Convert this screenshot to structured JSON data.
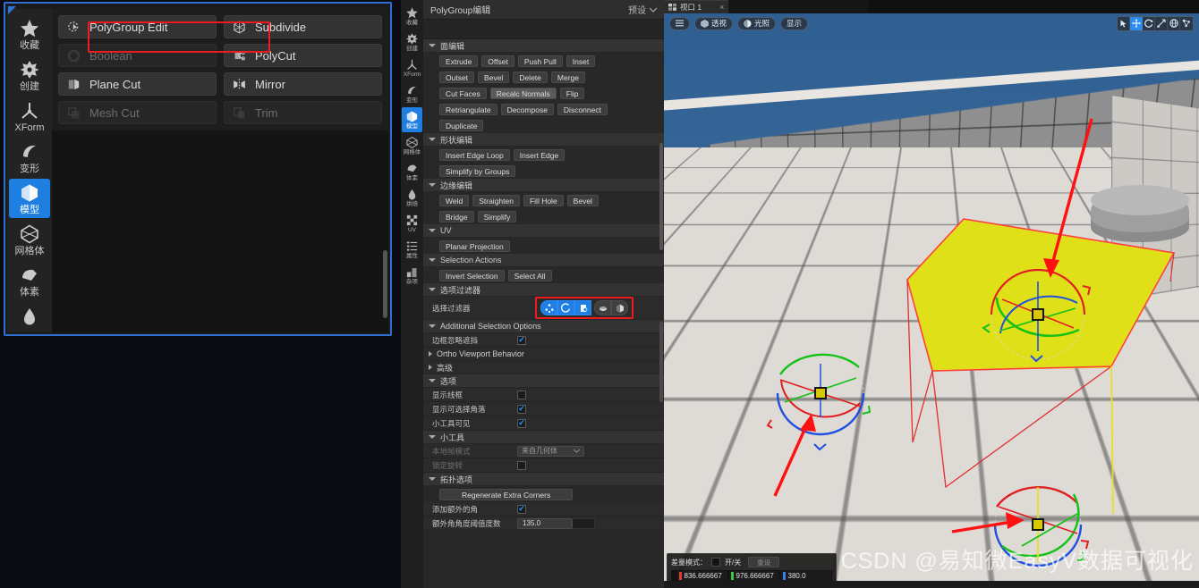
{
  "left_palette": {
    "rail_items": [
      {
        "label": "收藏",
        "icon": "star-icon",
        "active": false
      },
      {
        "label": "创建",
        "icon": "create-shape-icon",
        "active": false
      },
      {
        "label": "XForm",
        "icon": "xform-axis-icon",
        "active": false
      },
      {
        "label": "变形",
        "icon": "deform-icon",
        "active": false
      },
      {
        "label": "模型",
        "icon": "model-cube-icon",
        "active": true
      },
      {
        "label": "网格体",
        "icon": "mesh-polyhedron-icon",
        "active": false
      },
      {
        "label": "体素",
        "icon": "voxel-icon",
        "active": false
      },
      {
        "label": "",
        "icon": "bake-drop-icon",
        "active": false
      }
    ],
    "tools": [
      {
        "label": "PolyGroup Edit",
        "icon": "polygroup-edit-icon",
        "enabled": true,
        "highlighted": true
      },
      {
        "label": "Subdivide",
        "icon": "subdivide-icon",
        "enabled": true,
        "highlighted": false
      },
      {
        "label": "Boolean",
        "icon": "boolean-icon",
        "enabled": false,
        "highlighted": false
      },
      {
        "label": "PolyCut",
        "icon": "polycut-icon",
        "enabled": true,
        "highlighted": false
      },
      {
        "label": "Plane Cut",
        "icon": "plane-cut-icon",
        "enabled": true,
        "highlighted": false
      },
      {
        "label": "Mirror",
        "icon": "mirror-icon",
        "enabled": true,
        "highlighted": false
      },
      {
        "label": "Mesh Cut",
        "icon": "mesh-cut-icon",
        "enabled": false,
        "highlighted": false
      },
      {
        "label": "Trim",
        "icon": "trim-icon",
        "enabled": false,
        "highlighted": false
      }
    ],
    "highlight_color": "#ee1c1c",
    "border_color": "#2e6fd0"
  },
  "mid_panel": {
    "rail_items": [
      {
        "label": "收藏",
        "icon": "star-icon",
        "active": false
      },
      {
        "label": "创建",
        "icon": "create-shape-icon",
        "active": false
      },
      {
        "label": "XForm",
        "icon": "xform-axis-icon",
        "active": false
      },
      {
        "label": "变形",
        "icon": "deform-icon",
        "active": false
      },
      {
        "label": "模型",
        "icon": "model-cube-icon",
        "active": true
      },
      {
        "label": "网格体",
        "icon": "mesh-polyhedron-icon",
        "active": false
      },
      {
        "label": "体素",
        "icon": "voxel-icon",
        "active": false
      },
      {
        "label": "烘焙",
        "icon": "bake-drop-icon",
        "active": false
      },
      {
        "label": "UV",
        "icon": "uv-checker-icon",
        "active": false
      },
      {
        "label": "属性",
        "icon": "attributes-list-icon",
        "active": false
      },
      {
        "label": "杂项",
        "icon": "misc-icon",
        "active": false
      }
    ],
    "header": {
      "title": "PolyGroup编辑",
      "preset_label": "预设"
    },
    "sections": [
      {
        "name": "面编辑",
        "button_rows": [
          [
            {
              "label": "Extrude"
            },
            {
              "label": "Offset"
            },
            {
              "label": "Push Pull"
            },
            {
              "label": "Inset"
            }
          ],
          [
            {
              "label": "Outset"
            },
            {
              "label": "Bevel"
            },
            {
              "label": "Delete"
            },
            {
              "label": "Merge"
            }
          ],
          [
            {
              "label": "Cut Faces"
            },
            {
              "label": "Recalc Normals",
              "highlighted": true
            },
            {
              "label": "Flip"
            }
          ],
          [
            {
              "label": "Retriangulate"
            },
            {
              "label": "Decompose"
            },
            {
              "label": "Disconnect"
            }
          ],
          [
            {
              "label": "Duplicate"
            }
          ]
        ]
      },
      {
        "name": "形状编辑",
        "button_rows": [
          [
            {
              "label": "Insert Edge Loop"
            },
            {
              "label": "Insert Edge"
            }
          ],
          [
            {
              "label": "Simplify by Groups"
            }
          ]
        ]
      },
      {
        "name": "边缘编辑",
        "button_rows": [
          [
            {
              "label": "Weld"
            },
            {
              "label": "Straighten"
            },
            {
              "label": "Fill Hole"
            },
            {
              "label": "Bevel"
            }
          ],
          [
            {
              "label": "Bridge"
            },
            {
              "label": "Simplify"
            }
          ]
        ]
      },
      {
        "name": "UV",
        "button_rows": [
          [
            {
              "label": "Planar Projection"
            }
          ]
        ]
      },
      {
        "name": "Selection Actions",
        "button_rows": [
          [
            {
              "label": "Invert Selection"
            },
            {
              "label": "Select All"
            }
          ]
        ]
      }
    ],
    "filter_section": {
      "header": "选项过滤器",
      "row_label": "选择过滤器",
      "buttons": [
        {
          "icon": "vertex-filter-icon",
          "on": true
        },
        {
          "icon": "edge-filter-icon",
          "on": true
        },
        {
          "icon": "face-filter-icon",
          "on": true
        },
        {
          "icon": "mesh-filter-icon",
          "on": false
        },
        {
          "icon": "group-filter-icon",
          "on": false
        }
      ],
      "highlight_color": "#ee1c1c"
    },
    "additional": {
      "header": "Additional Selection Options",
      "rows": [
        {
          "label": "边框忽略遮挡",
          "type": "checkbox",
          "value": true
        }
      ],
      "collapsed": [
        {
          "label": "Ortho Viewport Behavior"
        },
        {
          "label": "高级"
        }
      ]
    },
    "options_section": {
      "header": "选项",
      "rows": [
        {
          "label": "显示线框",
          "type": "checkbox",
          "value": false
        },
        {
          "label": "显示可选择角落",
          "type": "checkbox",
          "value": true
        },
        {
          "label": "小工具可见",
          "type": "checkbox",
          "value": true
        }
      ]
    },
    "gizmo_section": {
      "header": "小工具",
      "rows": [
        {
          "label": "本地帧模式",
          "type": "select",
          "value": "来自几何体",
          "dimmed": true
        },
        {
          "label": "锁定旋转",
          "type": "checkbox",
          "value": false,
          "dimmed": true
        }
      ]
    },
    "topology_section": {
      "header": "拓扑选项",
      "button": "Regenerate Extra Corners",
      "rows": [
        {
          "label": "添加额外的角",
          "type": "checkbox",
          "value": true
        },
        {
          "label": "额外角角度阈值度数",
          "type": "number",
          "value": "135.0"
        }
      ]
    }
  },
  "viewport": {
    "tab": {
      "label": "视口 1",
      "close": "×"
    },
    "toolbar_left": [
      {
        "label": "",
        "icon": "hamburger-menu-icon"
      },
      {
        "label": "透视",
        "icon": "perspective-icon"
      },
      {
        "label": "光照",
        "icon": "lighting-icon"
      },
      {
        "label": "显示",
        "icon": "show-icon"
      }
    ],
    "toolbar_right": [
      {
        "icon": "select-cursor-icon",
        "on": false
      },
      {
        "icon": "move-gizmo-icon",
        "on": true
      },
      {
        "icon": "rotate-gizmo-icon",
        "on": false
      },
      {
        "icon": "scale-gizmo-icon",
        "on": false
      },
      {
        "icon": "world-coords-icon",
        "on": false
      },
      {
        "icon": "snap-icon",
        "on": false
      }
    ],
    "status": {
      "delta_label": "差量模式：",
      "toggle_label": "开/关",
      "reset_label": "重设",
      "coords": [
        {
          "value": "836.666667",
          "color": "#e03a2f"
        },
        {
          "value": "976.666667",
          "color": "#45c245"
        },
        {
          "value": "380.0",
          "color": "#3b7de0"
        }
      ]
    },
    "watermark": "CSDN @易知微EasyV数据可视化",
    "scene": {
      "selected_face_color": "#e0e018",
      "gizmo_count": 3,
      "annotation_arrow_color": "#ff0000",
      "annotation_arrow_count": 3
    }
  }
}
